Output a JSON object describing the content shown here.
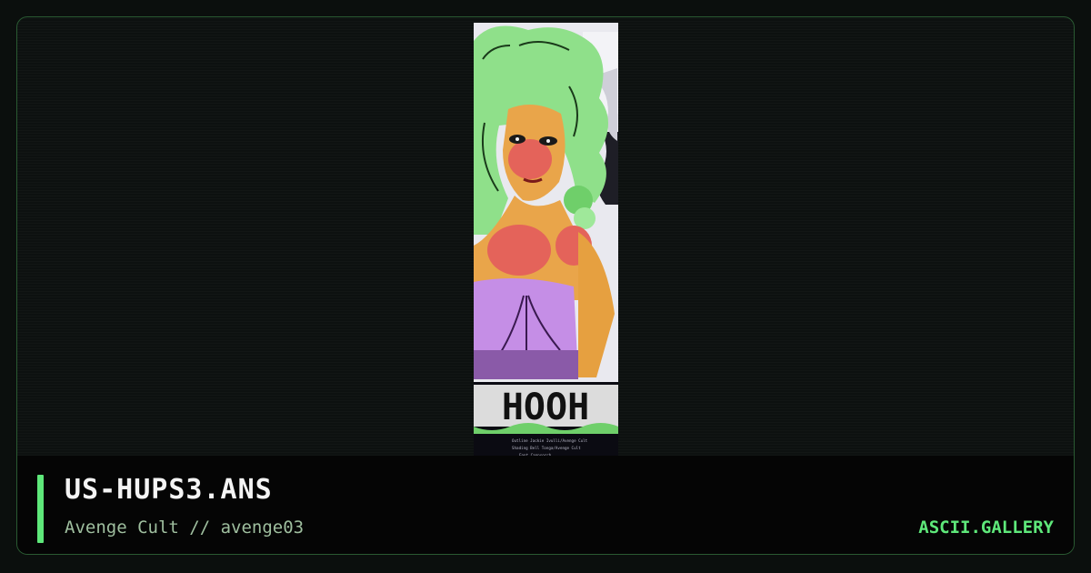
{
  "artwork": {
    "title": "US-HUPS3.ANS",
    "byline": "Avenge Cult // avenge03",
    "banner_text": "HOOH",
    "credits": [
      "Outline  Jackie Ivulli/Avenge Cult",
      "Shading  Bell Tonga/Avenge Cult",
      "Font  Cappsorch"
    ]
  },
  "site": {
    "brand": "ASCII.GALLERY"
  },
  "colors": {
    "accent": "#5ee87a",
    "hair": "#8fe08a",
    "skin": "#e4635a",
    "dress": "#c58ee6",
    "background_art": "#e8e8ee"
  }
}
